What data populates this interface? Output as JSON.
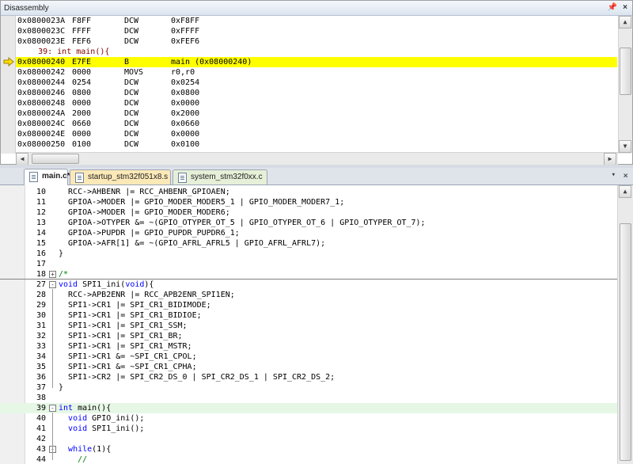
{
  "disassembly": {
    "title": "Disassembly",
    "pin_icon": "pin-icon",
    "close_icon": "close-icon",
    "rows": [
      {
        "addr": "0x0800023A",
        "code": "F8FF",
        "mnem": "DCW",
        "op": "0xF8FF",
        "current": false
      },
      {
        "addr": "0x0800023C",
        "code": "FFFF",
        "mnem": "DCW",
        "op": "0xFFFF",
        "current": false
      },
      {
        "addr": "0x0800023E",
        "code": "FEF6",
        "mnem": "DCW",
        "op": "0xFEF6",
        "current": false
      },
      {
        "src": "    39: int main(){"
      },
      {
        "addr": "0x08000240",
        "code": "E7FE",
        "mnem": "B",
        "op": "main (0x08000240)",
        "current": true
      },
      {
        "addr": "0x08000242",
        "code": "0000",
        "mnem": "MOVS",
        "op": "r0,r0",
        "current": false
      },
      {
        "addr": "0x08000244",
        "code": "0254",
        "mnem": "DCW",
        "op": "0x0254",
        "current": false
      },
      {
        "addr": "0x08000246",
        "code": "0800",
        "mnem": "DCW",
        "op": "0x0800",
        "current": false
      },
      {
        "addr": "0x08000248",
        "code": "0000",
        "mnem": "DCW",
        "op": "0x0000",
        "current": false
      },
      {
        "addr": "0x0800024A",
        "code": "2000",
        "mnem": "DCW",
        "op": "0x2000",
        "current": false
      },
      {
        "addr": "0x0800024C",
        "code": "0660",
        "mnem": "DCW",
        "op": "0x0660",
        "current": false
      },
      {
        "addr": "0x0800024E",
        "code": "0000",
        "mnem": "DCW",
        "op": "0x0000",
        "current": false
      },
      {
        "addr": "0x08000250",
        "code": "0100",
        "mnem": "DCW",
        "op": "0x0100",
        "current": false
      }
    ]
  },
  "tabs": [
    {
      "label": "main.c*",
      "active": true
    },
    {
      "label": "startup_stm32f051x8.s",
      "active": false
    },
    {
      "label": "system_stm32f0xx.c",
      "active": false
    }
  ],
  "tab_controls": {
    "down": "▾",
    "close": "×"
  },
  "editor": {
    "lines": [
      {
        "n": "10",
        "text": "  RCC->AHBENR |= RCC_AHBENR_GPIOAEN;"
      },
      {
        "n": "11",
        "text": "  GPIOA->MODER |= GPIO_MODER_MODER5_1 | GPIO_MODER_MODER7_1;"
      },
      {
        "n": "12",
        "text": "  GPIOA->MODER |= GPIO_MODER_MODER6;"
      },
      {
        "n": "13",
        "text": "  GPIOA->OTYPER &= ~(GPIO_OTYPER_OT_5 | GPIO_OTYPER_OT_6 | GPIO_OTYPER_OT_7);"
      },
      {
        "n": "14",
        "text": "  GPIOA->PUPDR |= GPIO_PUPDR_PUPDR6_1;"
      },
      {
        "n": "15",
        "text": "  GPIOA->AFR[1] &= ~(GPIO_AFRL_AFRL5 | GPIO_AFRL_AFRL7);"
      },
      {
        "n": "16",
        "text": "}"
      },
      {
        "n": "17",
        "text": ""
      },
      {
        "n": "18",
        "text": "/*",
        "fold": "+",
        "comment": true
      },
      {
        "n": "27",
        "text": "void SPI1_ini(void){",
        "fold": "-"
      },
      {
        "n": "28",
        "text": "  RCC->APB2ENR |= RCC_APB2ENR_SPI1EN;"
      },
      {
        "n": "29",
        "text": "  SPI1->CR1 |= SPI_CR1_BIDIMODE;"
      },
      {
        "n": "30",
        "text": "  SPI1->CR1 |= SPI_CR1_BIDIOE;"
      },
      {
        "n": "31",
        "text": "  SPI1->CR1 |= SPI_CR1_SSM;"
      },
      {
        "n": "32",
        "text": "  SPI1->CR1 |= SPI_CR1_BR;"
      },
      {
        "n": "33",
        "text": "  SPI1->CR1 |= SPI_CR1_MSTR;"
      },
      {
        "n": "34",
        "text": "  SPI1->CR1 &= ~SPI_CR1_CPOL;"
      },
      {
        "n": "35",
        "text": "  SPI1->CR1 &= ~SPI_CR1_CPHA;"
      },
      {
        "n": "36",
        "text": "  SPI1->CR2 |= SPI_CR2_DS_0 | SPI_CR2_DS_1 | SPI_CR2_DS_2;"
      },
      {
        "n": "37",
        "text": "}"
      },
      {
        "n": "38",
        "text": ""
      },
      {
        "n": "39",
        "text": "int main(){",
        "fold": "-",
        "current": true
      },
      {
        "n": "40",
        "text": "  void GPIO_ini();"
      },
      {
        "n": "41",
        "text": "  void SPI1_ini();"
      },
      {
        "n": "42",
        "text": ""
      },
      {
        "n": "43",
        "text": "  while(1){",
        "fold": "-"
      },
      {
        "n": "44",
        "text": "    //",
        "comment": true
      }
    ]
  },
  "colors": {
    "current_line": "#ffff00",
    "exec_highlight": "#e6f7e6",
    "keyword": "#0000ff",
    "comment": "#008000"
  }
}
